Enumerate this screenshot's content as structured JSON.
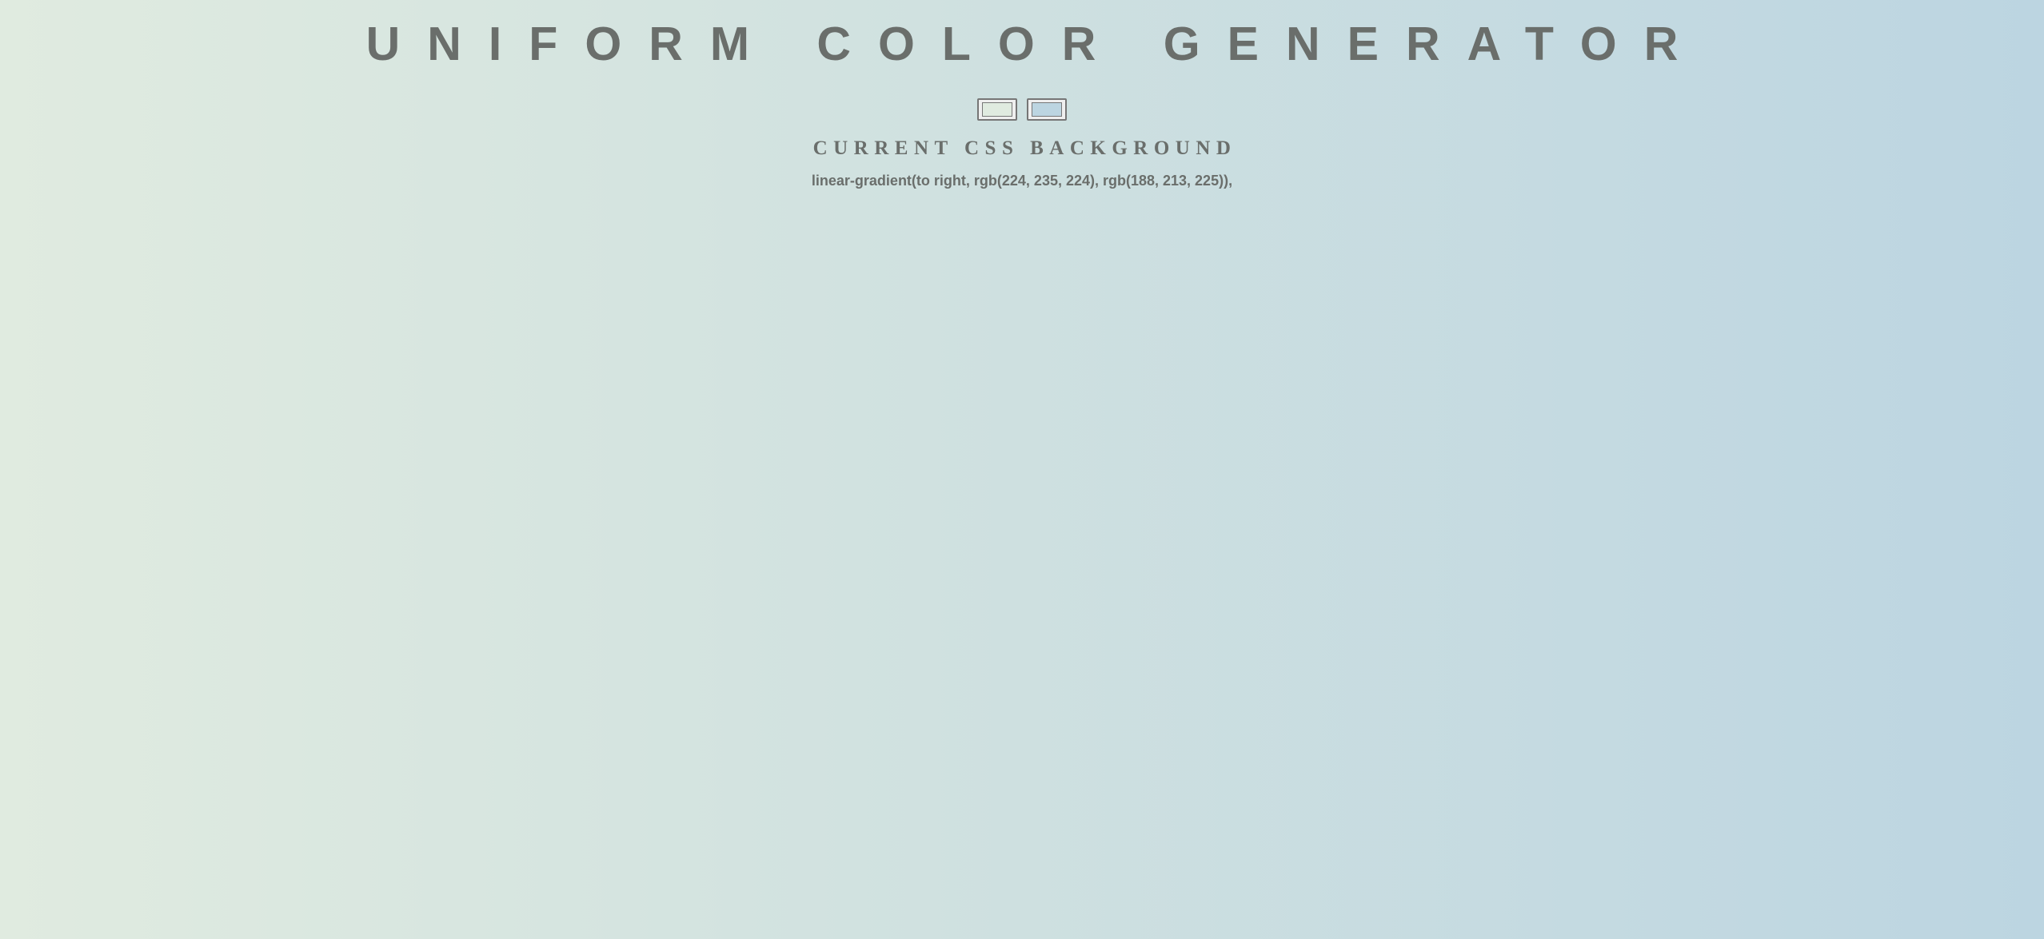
{
  "page": {
    "title": "UNIFORM COLOR GENERATOR",
    "subtitle": "CURRENT CSS BACKGROUND",
    "css_value": "linear-gradient(to right, rgb(224, 235, 224), rgb(188, 213, 225)),"
  },
  "pickers": {
    "color1": "#e0ebe0",
    "color2": "#bcd5e1"
  },
  "colors": {
    "text": "#6a6e6b",
    "gradient_start": "rgb(224, 235, 224)",
    "gradient_end": "rgb(188, 213, 225)"
  }
}
